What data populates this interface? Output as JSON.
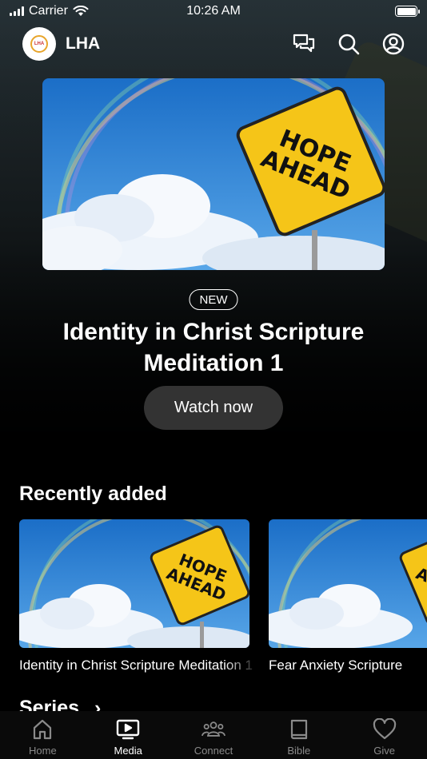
{
  "status_bar": {
    "carrier": "Carrier",
    "time": "10:26 AM"
  },
  "header": {
    "app_name": "LHA",
    "logo_text": "LHA"
  },
  "hero": {
    "badge": "NEW",
    "title": "Identity in Christ Scripture Meditation 1",
    "cta": "Watch now",
    "image_sign_text": [
      "HOPE",
      "AHEAD"
    ]
  },
  "recently_added": {
    "title": "Recently added",
    "items": [
      {
        "caption": "Identity in Christ Scripture Meditation 1"
      },
      {
        "caption": "Fear Anxiety Scripture"
      }
    ]
  },
  "series": {
    "title": "Series"
  },
  "tabs": [
    {
      "label": "Home",
      "icon": "home-icon",
      "active": false
    },
    {
      "label": "Media",
      "icon": "media-icon",
      "active": true
    },
    {
      "label": "Connect",
      "icon": "people-icon",
      "active": false
    },
    {
      "label": "Bible",
      "icon": "book-icon",
      "active": false
    },
    {
      "label": "Give",
      "icon": "heart-icon",
      "active": false
    }
  ],
  "colors": {
    "sign_yellow": "#f5c518",
    "sky_blue": "#3a8fd6",
    "button_bg": "#333333"
  }
}
